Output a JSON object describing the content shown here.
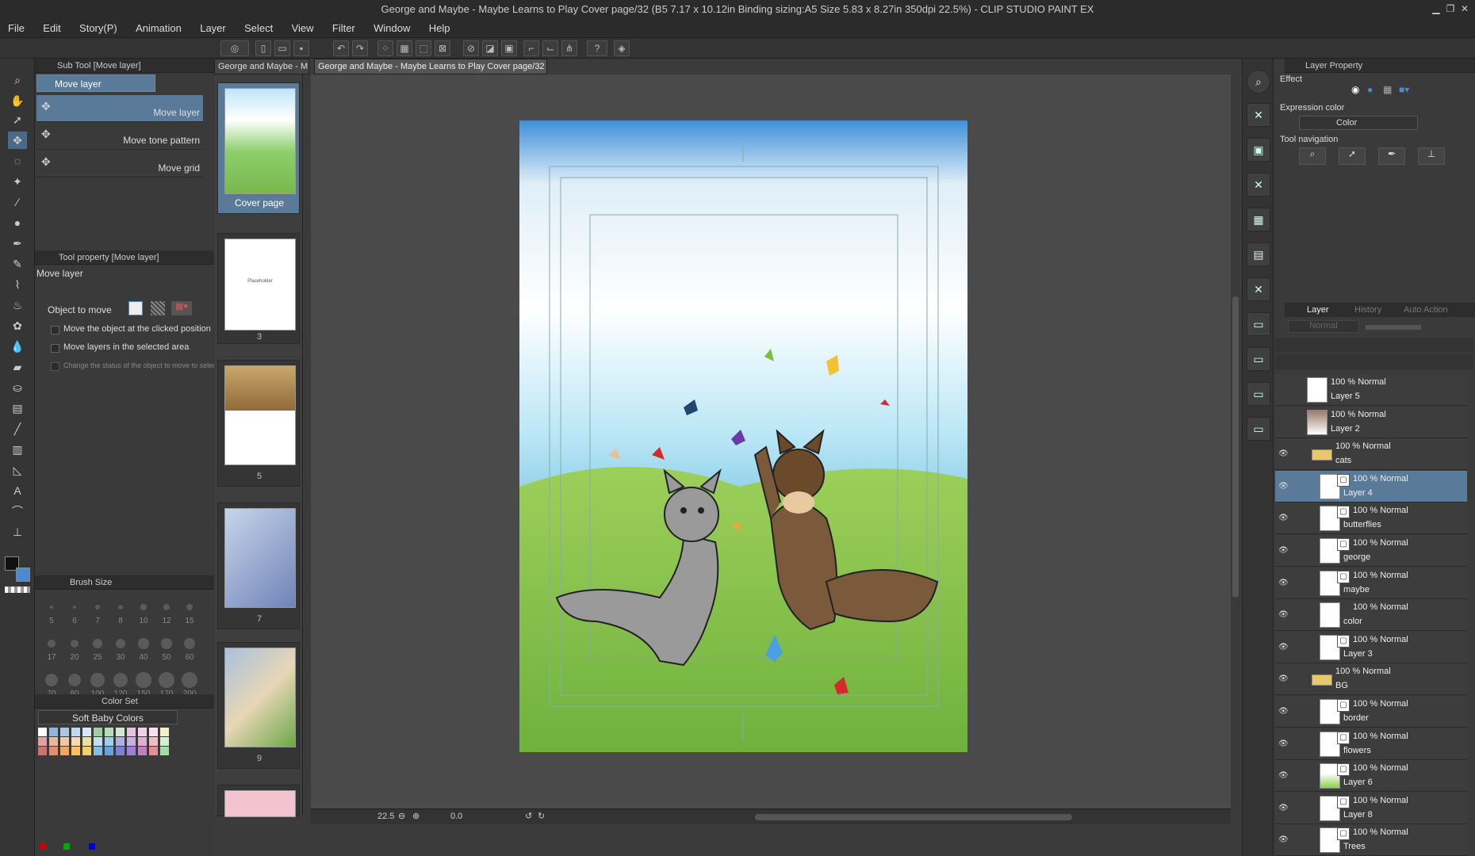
{
  "window": {
    "title": "George and Maybe - Maybe Learns to Play Cover page/32 (B5 7.17 x 10.12in Binding sizing:A5 Size 5.83 x 8.27in 350dpi 22.5%) - CLIP STUDIO PAINT EX"
  },
  "menu": [
    "File",
    "Edit",
    "Story(P)",
    "Animation",
    "Layer",
    "Select",
    "View",
    "Filter",
    "Window",
    "Help"
  ],
  "tabs": {
    "doc_short": "George and Maybe - M",
    "doc_full": "George and Maybe - Maybe Learns to Play Cover page/32"
  },
  "subtool": {
    "header": "Sub Tool [Move layer]",
    "group": "Move layer",
    "items": [
      "Move layer",
      "Move tone pattern",
      "Move grid"
    ]
  },
  "toolprop": {
    "header": "Tool property [Move layer]",
    "name": "Move layer",
    "object_to_move": "Object to move",
    "opt1": "Move the object at the clicked position",
    "opt2": "Move layers in the selected area",
    "opt3": "Change the status of the object to move to select"
  },
  "brush": {
    "header": "Brush Size",
    "sizes": [
      "5",
      "6",
      "7",
      "8",
      "10",
      "12",
      "15",
      "17",
      "20",
      "25",
      "30",
      "40",
      "50",
      "60",
      "70",
      "80",
      "100",
      "120",
      "150",
      "170",
      "200"
    ]
  },
  "colorset": {
    "header": "Color Set",
    "name": "Soft Baby Colors",
    "row1": [
      "#ffffff",
      "#8fb8e0",
      "#a8c8e8",
      "#c0d8f0",
      "#d8e8f8",
      "#9fcf9f",
      "#b8dcb8",
      "#d0e8d0",
      "#e8c0e0",
      "#f0d0e8",
      "#f8e0f0",
      "#f0f0c0"
    ],
    "row2": [
      "#e0a0a0",
      "#e8b8a0",
      "#f0c8a8",
      "#f8d8b0",
      "#f0e0a0",
      "#c0e0f0",
      "#a0d0e8",
      "#b0b0e0",
      "#c8b0e0",
      "#e0b0d0",
      "#f0c0c0",
      "#d0f0d0"
    ],
    "row3": [
      "#d07070",
      "#e09070",
      "#f0a860",
      "#f8c060",
      "#f0d070",
      "#80c0e0",
      "#70a0d8",
      "#8080d0",
      "#a080d0",
      "#c080c0",
      "#e09090",
      "#a0e0a0"
    ]
  },
  "pages": {
    "cover_label": "Cover page",
    "nums": [
      "3",
      "5",
      "7",
      "9"
    ],
    "placeholder": "Placeholder"
  },
  "status": {
    "zoom": "22.5",
    "angle": "0.0"
  },
  "layer_property": {
    "header": "Layer Property",
    "effect": "Effect",
    "expression_color": "Expression color",
    "color_mode": "Color",
    "tool_navigation": "Tool navigation"
  },
  "layer_panel": {
    "tabs": [
      "Layer",
      "History",
      "Auto Action"
    ],
    "blend": "Normal",
    "layers": [
      {
        "mode": "100 % Normal",
        "name": "Layer 5"
      },
      {
        "mode": "100 % Normal",
        "name": "Layer 2"
      },
      {
        "mode": "100 % Normal",
        "name": "cats"
      },
      {
        "mode": "100 % Normal",
        "name": "Layer 4"
      },
      {
        "mode": "100 % Normal",
        "name": "butterflies"
      },
      {
        "mode": "100 % Normal",
        "name": "george"
      },
      {
        "mode": "100 % Normal",
        "name": "maybe"
      },
      {
        "mode": "100 % Normal",
        "name": "color"
      },
      {
        "mode": "100 % Normal",
        "name": "Layer 3"
      },
      {
        "mode": "100 % Normal",
        "name": "BG"
      },
      {
        "mode": "100 % Normal",
        "name": "border"
      },
      {
        "mode": "100 % Normal",
        "name": "flowers"
      },
      {
        "mode": "100 % Normal",
        "name": "Layer 6"
      },
      {
        "mode": "100 % Normal",
        "name": "Layer 8"
      },
      {
        "mode": "100 % Normal",
        "name": "Trees"
      }
    ]
  }
}
